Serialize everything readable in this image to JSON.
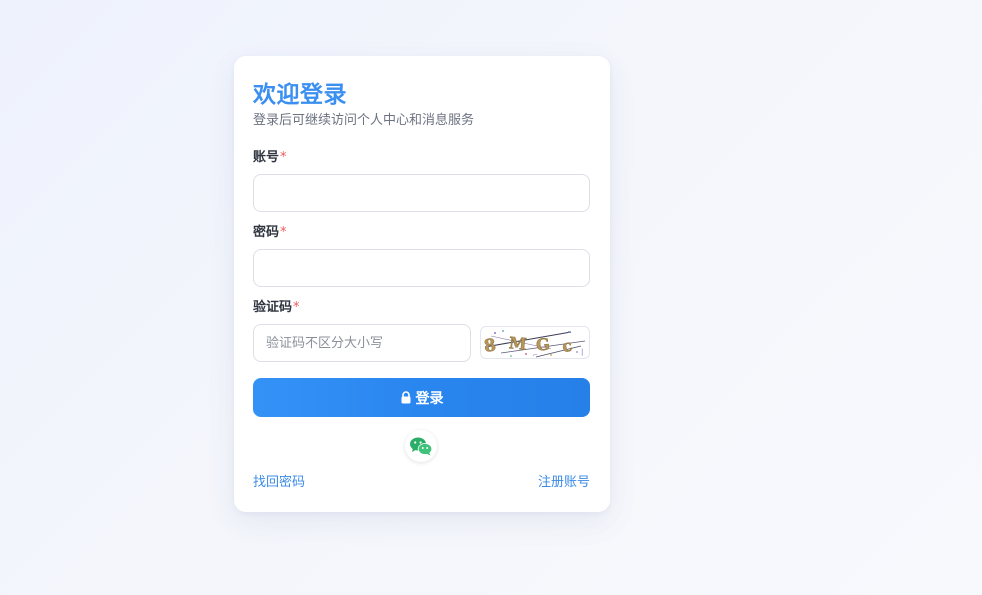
{
  "login": {
    "title": "欢迎登录",
    "subtitle": "登录后可继续访问个人中心和消息服务",
    "account": {
      "label": "账号",
      "required_mark": "*",
      "value": "",
      "placeholder": ""
    },
    "password": {
      "label": "密码",
      "required_mark": "*",
      "value": "",
      "placeholder": ""
    },
    "captcha": {
      "label": "验证码",
      "required_mark": "*",
      "value": "",
      "placeholder": "验证码不区分大小写",
      "image_text": "8 M G c"
    },
    "submit_label": "登录",
    "submit_icon": "lock-icon",
    "social_icon": "wechat-icon",
    "forgot_password_link": "找回密码",
    "register_link": "注册账号"
  },
  "colors": {
    "accent": "#3a8ff0",
    "button": "#2a86ef",
    "required": "#f05a5a",
    "link": "#3b8be8",
    "wechat": "#2aae67"
  }
}
